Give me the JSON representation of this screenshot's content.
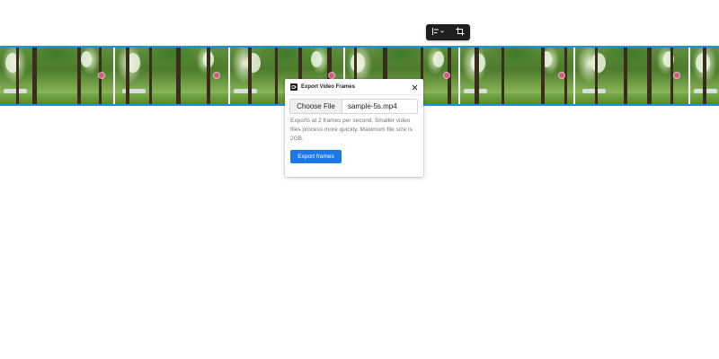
{
  "toolbar": {
    "icons": [
      "align-icon",
      "chevron-down-icon",
      "crop-icon"
    ]
  },
  "filmstrip": {
    "frame_count": 7,
    "selection_color": "#1e8fe8",
    "pin_color": "#ec4d8b"
  },
  "dialog": {
    "title": "Export Video Frames",
    "choose_file_label": "Choose File",
    "file_name": "sample-5s.mp4",
    "help_text": "Exports at 2 frames per second. Smaller video files process more quickly. Maximum file size is 2GB.",
    "export_button_label": "Export frames",
    "accent_color": "#1e78e6"
  }
}
